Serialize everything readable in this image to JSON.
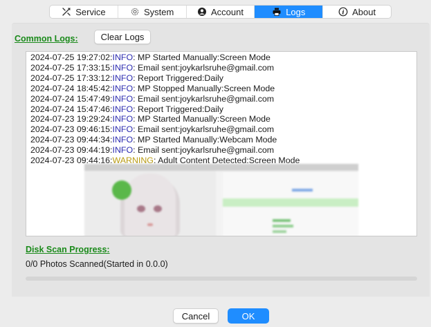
{
  "tabs": [
    {
      "label": "Service",
      "icon": "wrench-screwdriver-icon",
      "active": false
    },
    {
      "label": "System",
      "icon": "gear-icon",
      "active": false
    },
    {
      "label": "Account",
      "icon": "user-circle-icon",
      "active": false
    },
    {
      "label": "Logs",
      "icon": "printer-icon",
      "active": true
    },
    {
      "label": "About",
      "icon": "info-icon",
      "active": false
    }
  ],
  "logs_section": {
    "title": "Common Logs:",
    "clear_label": "Clear Logs",
    "lines": [
      {
        "ts": "2024-07-25 19:27:02:",
        "level": "INFO",
        "msg": ": MP Started Manually:Screen Mode"
      },
      {
        "ts": "2024-07-25 17:33:15:",
        "level": "INFO",
        "msg": ": Email sent:joykarlsruhe@gmail.com"
      },
      {
        "ts": "2024-07-25 17:33:12:",
        "level": "INFO",
        "msg": ": Report Triggered:Daily"
      },
      {
        "ts": "2024-07-24 18:45:42:",
        "level": "INFO",
        "msg": ": MP Stopped Manually:Screen Mode"
      },
      {
        "ts": "2024-07-24 15:47:49:",
        "level": "INFO",
        "msg": ": Email sent:joykarlsruhe@gmail.com"
      },
      {
        "ts": "2024-07-24 15:47:46:",
        "level": "INFO",
        "msg": ": Report Triggered:Daily"
      },
      {
        "ts": "2024-07-23 19:29:24:",
        "level": "INFO",
        "msg": ": MP Started Manually:Screen Mode"
      },
      {
        "ts": "2024-07-23 09:46:15:",
        "level": "INFO",
        "msg": ": Email sent:joykarlsruhe@gmail.com"
      },
      {
        "ts": "2024-07-23 09:44:34:",
        "level": "INFO",
        "msg": ": MP Started Manually:Webcam Mode"
      },
      {
        "ts": "2024-07-23 09:44:19:",
        "level": "INFO",
        "msg": ": Email sent:joykarlsruhe@gmail.com"
      },
      {
        "ts": "2024-07-23 09:44:16:",
        "level": "WARNING",
        "msg": ": Adult Content Detected:Screen Mode"
      }
    ]
  },
  "disk_scan": {
    "title": "Disk Scan Progress:",
    "status": "0/0 Photos Scanned(Started in 0.0.0)",
    "progress_fraction": 0
  },
  "footer": {
    "cancel_label": "Cancel",
    "ok_label": "OK"
  },
  "colors": {
    "accent": "#1f8dff",
    "section_title": "#1a8a1a",
    "info": "#2b2bb0",
    "warning": "#b89a10"
  }
}
